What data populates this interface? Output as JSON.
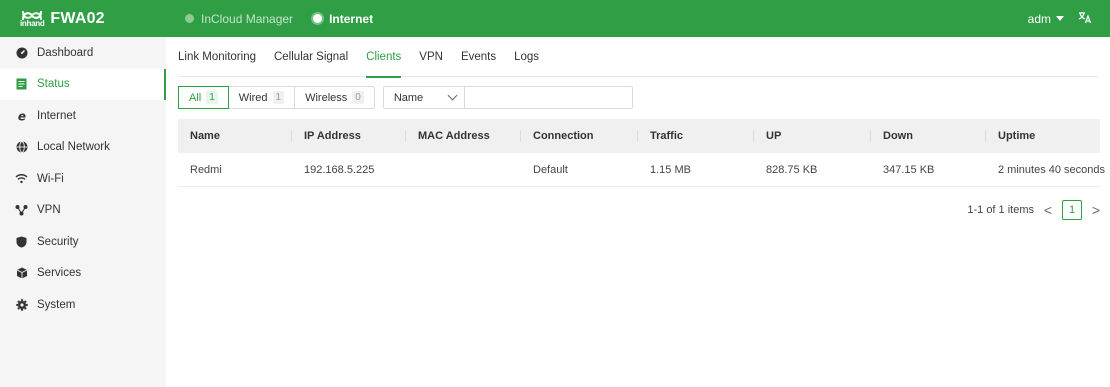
{
  "brand": {
    "logo_sub": "inhand",
    "name": "FWA02"
  },
  "top_tabs": [
    {
      "label": "InCloud Manager"
    },
    {
      "label": "Internet"
    }
  ],
  "top_right": {
    "user": "adm",
    "lang_icon": "translate-icon"
  },
  "sidebar": {
    "items": [
      {
        "label": "Dashboard",
        "icon": "dashboard-icon"
      },
      {
        "label": "Status",
        "icon": "status-icon"
      },
      {
        "label": "Internet",
        "icon": "internet-icon"
      },
      {
        "label": "Local Network",
        "icon": "globe-icon"
      },
      {
        "label": "Wi-Fi",
        "icon": "wifi-icon"
      },
      {
        "label": "VPN",
        "icon": "vpn-icon"
      },
      {
        "label": "Security",
        "icon": "shield-icon"
      },
      {
        "label": "Services",
        "icon": "services-icon"
      },
      {
        "label": "System",
        "icon": "gear-icon"
      }
    ]
  },
  "subtabs": [
    {
      "label": "Link Monitoring"
    },
    {
      "label": "Cellular Signal"
    },
    {
      "label": "Clients"
    },
    {
      "label": "VPN"
    },
    {
      "label": "Events"
    },
    {
      "label": "Logs"
    }
  ],
  "filters": {
    "segments": [
      {
        "label": "All",
        "count": "1"
      },
      {
        "label": "Wired",
        "count": "1"
      },
      {
        "label": "Wireless",
        "count": "0"
      }
    ],
    "field_select": "Name",
    "search_value": ""
  },
  "table": {
    "headers": [
      "Name",
      "IP Address",
      "MAC Address",
      "Connection",
      "Traffic",
      "UP",
      "Down",
      "Uptime"
    ],
    "rows": [
      [
        "Redmi",
        "192.168.5.225",
        "",
        "Default",
        "1.15 MB",
        "828.75 KB",
        "347.15 KB",
        "2 minutes 40 seconds"
      ]
    ]
  },
  "pagination": {
    "summary": "1-1 of 1 items",
    "current": "1",
    "prev": "<",
    "next": ">"
  },
  "colors": {
    "brand": "#2f9e45",
    "sidebar_bg": "#f5f5f5",
    "table_header_bg": "#f0f0f0"
  }
}
